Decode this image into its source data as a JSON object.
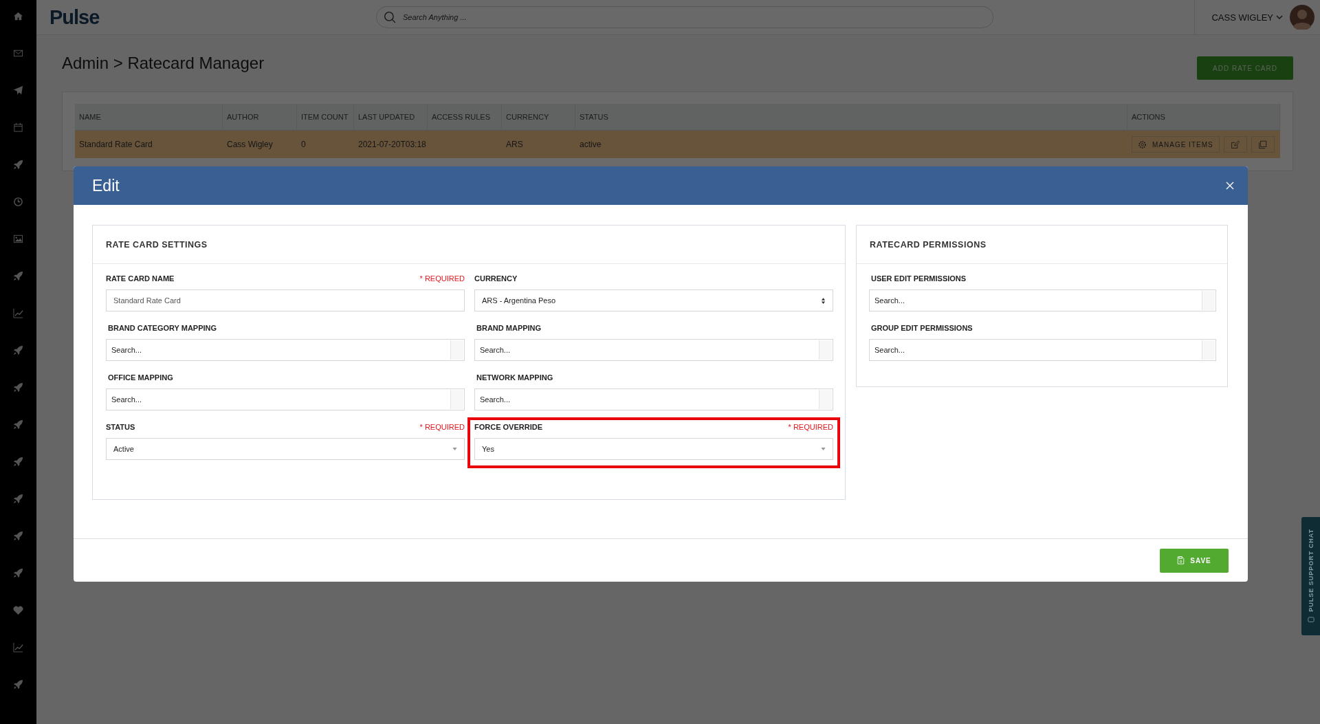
{
  "app": {
    "logo": "Pulse",
    "search_placeholder": "Search Anything ...",
    "user": "CASS WIGLEY"
  },
  "page": {
    "breadcrumb": "Admin > Ratecard Manager",
    "add_button": "ADD RATE CARD"
  },
  "table": {
    "columns": [
      "NAME",
      "AUTHOR",
      "ITEM COUNT",
      "LAST UPDATED",
      "ACCESS RULES",
      "CURRENCY",
      "STATUS",
      "ACTIONS"
    ],
    "rows": [
      {
        "selected": true,
        "cells": [
          "Standard Rate Card",
          "Cass Wigley",
          "0",
          "2021-07-20T03:18",
          "",
          "ARS",
          "active"
        ],
        "manage_button": "MANAGE ITEMS"
      }
    ]
  },
  "modal": {
    "title": "Edit",
    "settings": {
      "title": "RATE CARD SETTINGS",
      "fields": [
        {
          "kind": "text",
          "label": "RATE CARD NAME",
          "required_note": "* REQUIRED",
          "value": "Standard Rate Card",
          "highlighted": false
        },
        {
          "kind": "native-select",
          "label": "CURRENCY",
          "value": "ARS - Argentina Peso",
          "highlighted": false
        },
        {
          "kind": "search",
          "label": "BRAND CATEGORY MAPPING",
          "placeholder": "Search...",
          "highlighted": false
        },
        {
          "kind": "search",
          "label": "BRAND MAPPING",
          "placeholder": "Search...",
          "highlighted": false
        },
        {
          "kind": "search",
          "label": "OFFICE MAPPING",
          "placeholder": "Search...",
          "highlighted": false
        },
        {
          "kind": "search",
          "label": "NETWORK MAPPING",
          "placeholder": "Search...",
          "highlighted": false
        },
        {
          "kind": "dropdown",
          "label": "STATUS",
          "required_note": "* REQUIRED",
          "value": "Active",
          "highlighted": false
        },
        {
          "kind": "dropdown",
          "label": "FORCE OVERRIDE",
          "required_note": "* REQUIRED",
          "value": "Yes",
          "highlighted": true
        }
      ]
    },
    "permissions": {
      "title": "RATECARD PERMISSIONS",
      "fields": [
        {
          "kind": "search",
          "label": "USER EDIT PERMISSIONS",
          "placeholder": "Search...",
          "highlighted": false
        },
        {
          "kind": "search",
          "label": "GROUP EDIT PERMISSIONS",
          "placeholder": "Search...",
          "highlighted": false
        }
      ]
    },
    "save_button": "SAVE"
  },
  "support_chat": "PULSE SUPPORT CHAT"
}
